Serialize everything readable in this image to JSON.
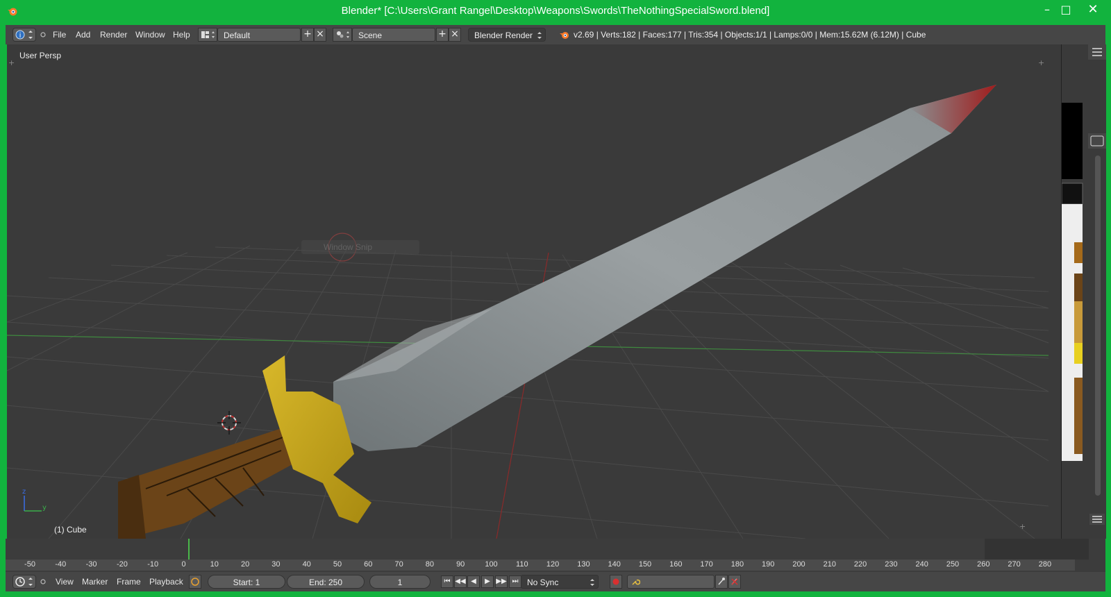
{
  "window": {
    "title": "Blender* [C:\\Users\\Grant Rangel\\Desktop\\Weapons\\Swords\\TheNothingSpecialSword.blend]",
    "minimize_glyph": "–",
    "maximize_glyph": "□",
    "close_glyph": "✕"
  },
  "info_header": {
    "menus": [
      "File",
      "Add",
      "Render",
      "Window",
      "Help"
    ],
    "screen_layout": "Default",
    "scene": "Scene",
    "render_engine": "Blender Render",
    "stats": "v2.69 | Verts:182 | Faces:177 | Tris:354 | Objects:1/1 | Lamps:0/0 | Mem:15.62M (6.12M) | Cube"
  },
  "viewport": {
    "view_label": "User Persp",
    "object_label": "(1) Cube",
    "ghost_menu": "Window Snip",
    "axis_y": "y",
    "axis_z": "z"
  },
  "timeline": {
    "ticks": [
      "-50",
      "-40",
      "-30",
      "-20",
      "-10",
      "0",
      "10",
      "20",
      "30",
      "40",
      "50",
      "60",
      "70",
      "80",
      "90",
      "100",
      "110",
      "120",
      "130",
      "140",
      "150",
      "160",
      "170",
      "180",
      "190",
      "200",
      "210",
      "220",
      "230",
      "240",
      "250",
      "260",
      "270",
      "280"
    ],
    "current_frame_marker": 0
  },
  "timeline_header": {
    "menus": [
      "View",
      "Marker",
      "Frame",
      "Playback"
    ],
    "start": "Start: 1",
    "end": "End: 250",
    "current": "1",
    "sync": "No Sync"
  },
  "colors": {
    "border": "#12b33e",
    "panel": "#464646",
    "viewport_bg": "#3a3a3a",
    "blade": "#8a9294",
    "guard": "#c9a818",
    "handle": "#5a3a18",
    "blood": "#a02020"
  }
}
